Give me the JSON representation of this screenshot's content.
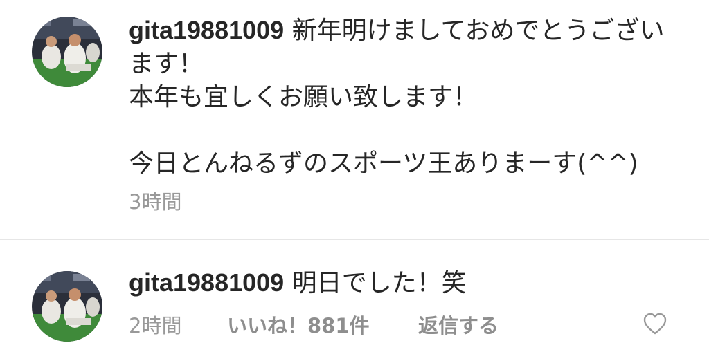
{
  "comments": [
    {
      "username": "gita19881009",
      "text": "新年明けましておめでとうございます！\n本年も宜しくお願い致します！\n\n今日とんねるずのスポーツ王ありまーす(^^)",
      "time": "3時間"
    },
    {
      "username": "gita19881009",
      "text": "明日でした！笑",
      "time": "2時間",
      "likes": "いいね！881件",
      "reply_label": "返信する",
      "like_icon": "heart-outline-icon"
    }
  ],
  "colors": {
    "text": "#262626",
    "meta": "#999999",
    "divider": "#e6e6e6"
  }
}
